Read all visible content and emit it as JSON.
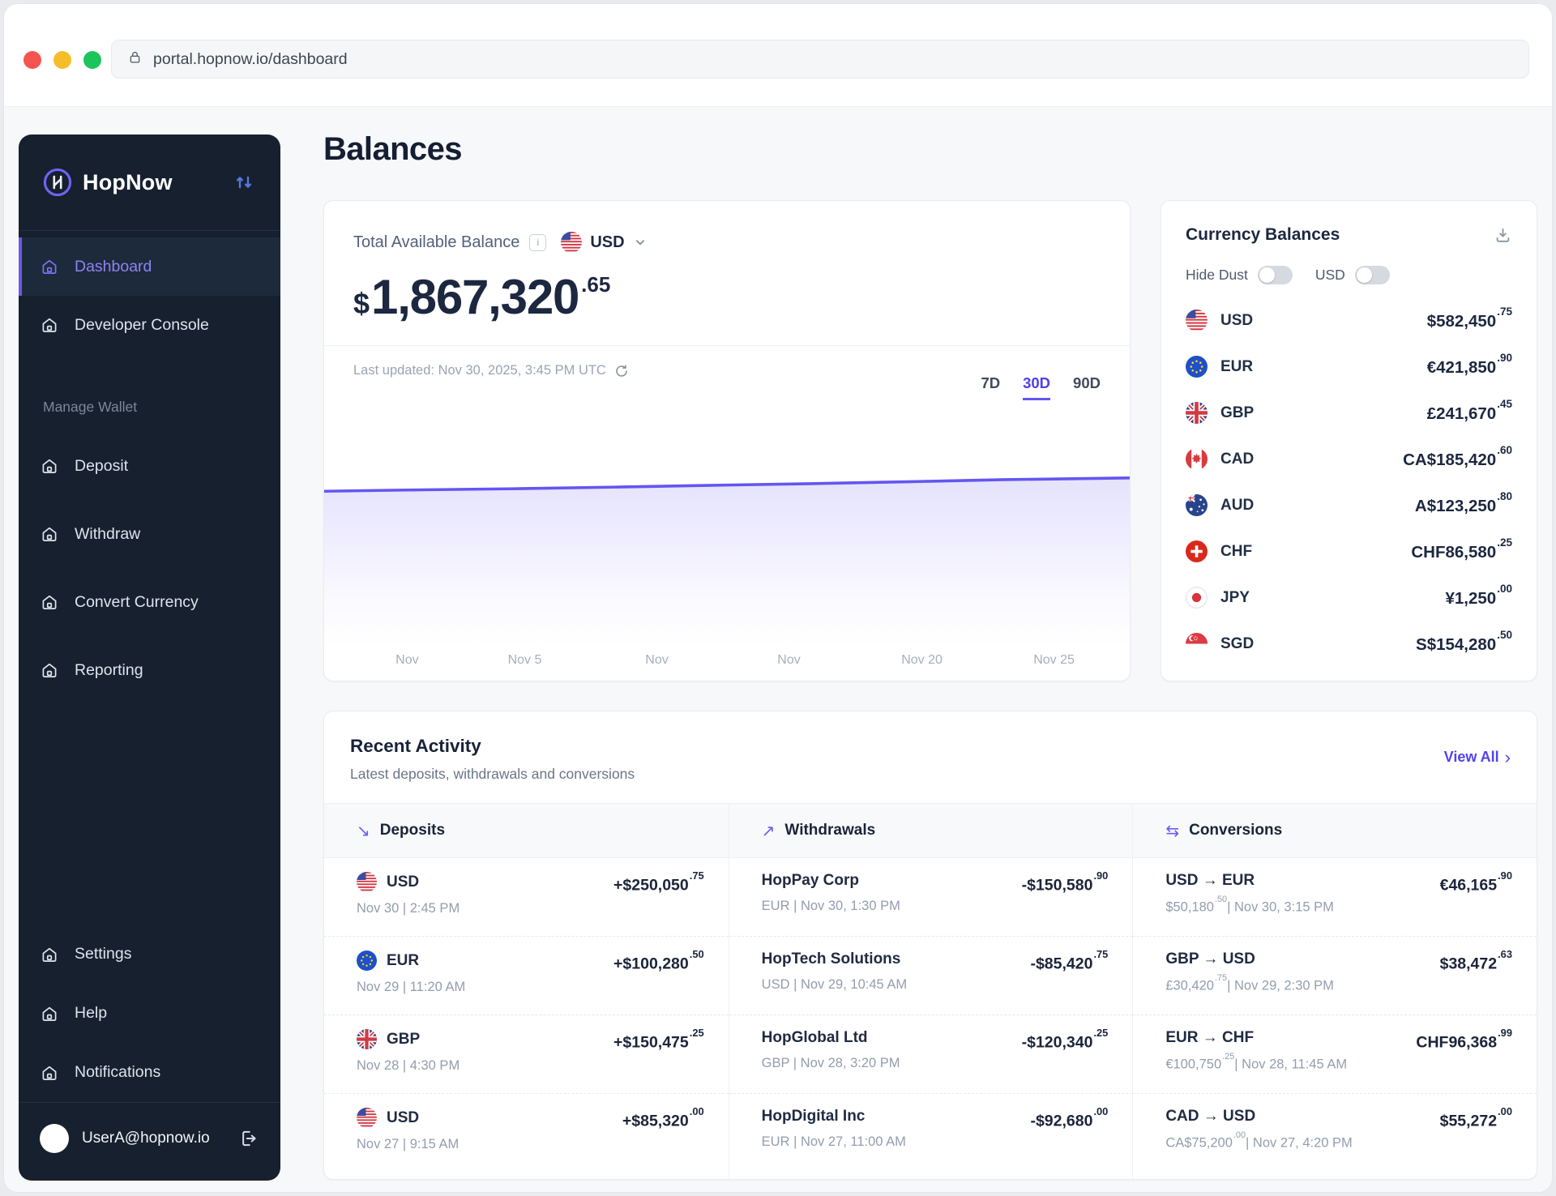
{
  "browser": {
    "url": "portal.hopnow.io/dashboard"
  },
  "sidebar": {
    "brand": "HopNow",
    "nav_main": [
      {
        "label": "Dashboard",
        "icon": "home-icon",
        "active": true
      },
      {
        "label": "Developer Console",
        "icon": "home-icon",
        "active": false
      }
    ],
    "section_label": "Manage Wallet",
    "nav_wallet": [
      {
        "label": "Deposit",
        "icon": "home-icon"
      },
      {
        "label": "Withdraw",
        "icon": "home-icon"
      },
      {
        "label": "Convert Currency",
        "icon": "home-icon"
      },
      {
        "label": "Reporting",
        "icon": "home-icon"
      }
    ],
    "nav_bottom": [
      {
        "label": "Settings",
        "icon": "home-icon"
      },
      {
        "label": "Help",
        "icon": "home-icon"
      },
      {
        "label": "Notifications",
        "icon": "home-icon"
      }
    ],
    "user_email": "UserA@hopnow.io"
  },
  "page_title": "Balances",
  "balance_card": {
    "label": "Total Available Balance",
    "info_icon": "info-icon",
    "currency": "USD",
    "currency_flag": "us",
    "amount_symbol": "$",
    "amount_main": "1,867,320",
    "amount_cents": "65",
    "last_updated": "Last updated: Nov 30, 2025, 3:45 PM UTC",
    "refresh_icon": "refresh-icon",
    "range_tabs": [
      "7D",
      "30D",
      "90D"
    ],
    "active_tab": "30D"
  },
  "chart_data": {
    "type": "line",
    "title": "Total available balance trend (30D)",
    "x_labels": [
      "Nov",
      "Nov 5",
      "Nov",
      "Nov",
      "Nov 20",
      "Nov 25"
    ],
    "trend": "near-flat line rising slightly left to right",
    "line_color": "#6456f0",
    "grid": false,
    "legend": false
  },
  "currency_panel": {
    "title": "Currency Balances",
    "download_icon": "download-icon",
    "toggles": [
      {
        "label": "Hide Dust",
        "on": false
      },
      {
        "label": "USD",
        "on": false
      }
    ],
    "rows": [
      {
        "code": "USD",
        "flag": "us",
        "amount_main": "$582,450",
        "amount_cents": "75"
      },
      {
        "code": "EUR",
        "flag": "eu",
        "amount_main": "€421,850",
        "amount_cents": "90"
      },
      {
        "code": "GBP",
        "flag": "gb",
        "amount_main": "£241,670",
        "amount_cents": "45"
      },
      {
        "code": "CAD",
        "flag": "ca",
        "amount_main": "CA$185,420",
        "amount_cents": "60"
      },
      {
        "code": "AUD",
        "flag": "au",
        "amount_main": "A$123,250",
        "amount_cents": "80"
      },
      {
        "code": "CHF",
        "flag": "ch",
        "amount_main": "CHF86,580",
        "amount_cents": "25"
      },
      {
        "code": "JPY",
        "flag": "jp",
        "amount_main": "¥1,250",
        "amount_cents": "00"
      },
      {
        "code": "SGD",
        "flag": "sg",
        "amount_main": "S$154,280",
        "amount_cents": "50"
      }
    ]
  },
  "activity": {
    "title": "Recent Activity",
    "subtitle": "Latest deposits, withdrawals and conversions",
    "view_all_label": "View All",
    "columns": [
      {
        "label": "Deposits",
        "icon": "arrow-down-right-icon"
      },
      {
        "label": "Withdrawals",
        "icon": "arrow-up-right-icon"
      },
      {
        "label": "Conversions",
        "icon": "swap-arrows-icon"
      }
    ],
    "deposits": [
      {
        "code": "USD",
        "flag": "us",
        "sub": "Nov 30 | 2:45 PM",
        "amount_main": "+$250,050",
        "amount_cents": "75"
      },
      {
        "code": "EUR",
        "flag": "eu",
        "sub": "Nov 29 | 11:20 AM",
        "amount_main": "+$100,280",
        "amount_cents": "50"
      },
      {
        "code": "GBP",
        "flag": "gb",
        "sub": "Nov 28 | 4:30 PM",
        "amount_main": "+$150,475",
        "amount_cents": "25"
      },
      {
        "code": "USD",
        "flag": "us",
        "sub": "Nov 27 | 9:15 AM",
        "amount_main": "+$85,320",
        "amount_cents": "00"
      }
    ],
    "withdrawals": [
      {
        "name": "HopPay Corp",
        "sub": "EUR | Nov 30, 1:30 PM",
        "amount_main": "-$150,580",
        "amount_cents": "90"
      },
      {
        "name": "HopTech Solutions",
        "sub": "USD | Nov 29, 10:45 AM",
        "amount_main": "-$85,420",
        "amount_cents": "75"
      },
      {
        "name": "HopGlobal Ltd",
        "sub": "GBP | Nov 28, 3:20 PM",
        "amount_main": "-$120,340",
        "amount_cents": "25"
      },
      {
        "name": "HopDigital Inc",
        "sub": "EUR | Nov 27, 11:00 AM",
        "amount_main": "-$92,680",
        "amount_cents": "00"
      }
    ],
    "conversions": [
      {
        "pair": "USD → EUR",
        "sub_amount_main": "$50,180",
        "sub_amount_cents": "50",
        "sub_datetime": "Nov 30, 3:15 PM",
        "amount_main": "€46,165",
        "amount_cents": "90"
      },
      {
        "pair": "GBP → USD",
        "sub_amount_main": "£30,420",
        "sub_amount_cents": "75",
        "sub_datetime": "Nov 29, 2:30 PM",
        "amount_main": "$38,472",
        "amount_cents": "63"
      },
      {
        "pair": "EUR → CHF",
        "sub_amount_main": "€100,750",
        "sub_amount_cents": "25",
        "sub_datetime": "Nov 28, 11:45 AM",
        "amount_main": "CHF96,368",
        "amount_cents": "99"
      },
      {
        "pair": "CAD → USD",
        "sub_amount_main": "CA$75,200",
        "sub_amount_cents": "00",
        "sub_datetime": "Nov 27, 4:20 PM",
        "amount_main": "$55,272",
        "amount_cents": "00"
      }
    ]
  }
}
